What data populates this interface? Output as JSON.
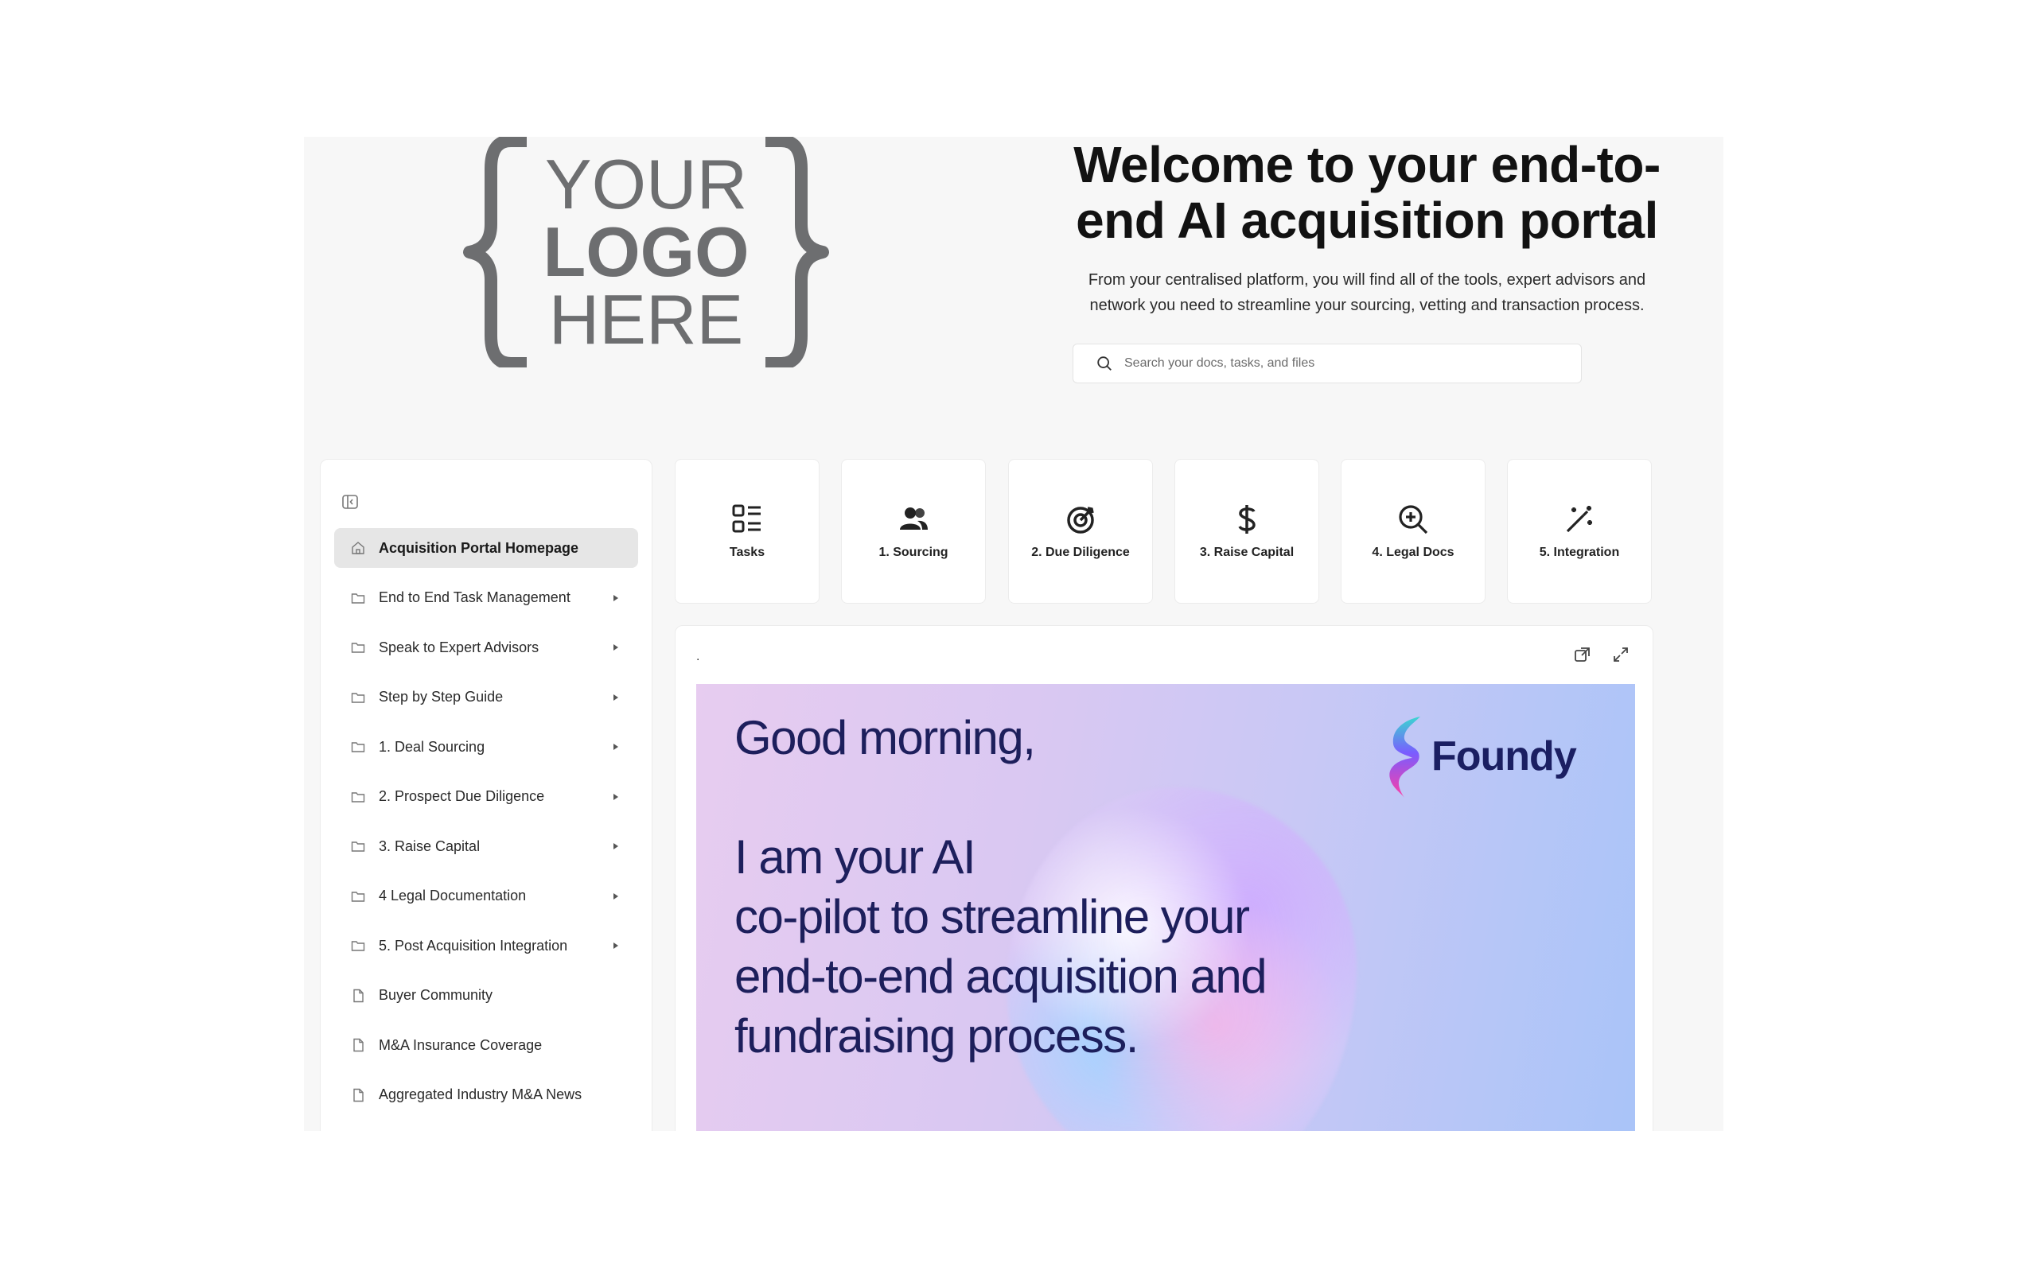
{
  "logo": {
    "line1": "YOUR",
    "line2": "LOGO",
    "line3": "HERE"
  },
  "hero": {
    "title_line1": "Welcome to your end-to-",
    "title_line2": "end AI acquisition portal",
    "subtitle_line1": "From your centralised platform, you will find all of the tools, expert advisors and",
    "subtitle_line2": "network you need to streamline your sourcing, vetting and transaction process."
  },
  "search": {
    "placeholder": "Search your docs, tasks, and files"
  },
  "sidebar": {
    "items": [
      {
        "label": "Acquisition Portal Homepage",
        "icon": "home-icon",
        "active": true
      },
      {
        "label": "End to End Task Management",
        "icon": "folder-icon",
        "expandable": true
      },
      {
        "label": "Speak to Expert Advisors",
        "icon": "folder-icon",
        "expandable": true
      },
      {
        "label": "Step by Step Guide",
        "icon": "folder-icon",
        "expandable": true
      },
      {
        "label": "1. Deal Sourcing",
        "icon": "folder-icon",
        "expandable": true
      },
      {
        "label": "2. Prospect Due Diligence",
        "icon": "folder-icon",
        "expandable": true
      },
      {
        "label": "3. Raise Capital",
        "icon": "folder-icon",
        "expandable": true
      },
      {
        "label": "4 Legal Documentation",
        "icon": "folder-icon",
        "expandable": true
      },
      {
        "label": "5. Post Acquisition Integration",
        "icon": "folder-icon",
        "expandable": true
      },
      {
        "label": "Buyer Community",
        "icon": "document-icon"
      },
      {
        "label": "M&A Insurance Coverage",
        "icon": "document-icon"
      },
      {
        "label": "Aggregated Industry M&A News",
        "icon": "document-icon"
      }
    ]
  },
  "tiles": [
    {
      "label": "Tasks",
      "icon": "tasks-grid-icon"
    },
    {
      "label": "1. Sourcing",
      "icon": "people-icon"
    },
    {
      "label": "2. Due Diligence",
      "icon": "target-icon"
    },
    {
      "label": "3. Raise Capital",
      "icon": "dollar-icon"
    },
    {
      "label": "4. Legal Docs",
      "icon": "zoom-in-icon"
    },
    {
      "label": "5. Integration",
      "icon": "magic-wand-icon"
    }
  ],
  "panel": {
    "marker": ".",
    "banner": {
      "line1": "Good morning,",
      "line2": "I am your AI",
      "line3": "co-pilot to streamline your",
      "line4": "end-to-end acquisition and",
      "line5": "fundraising process.",
      "brand": "Foundy"
    }
  },
  "colors": {
    "background": "#f7f7f7",
    "card": "#ffffff",
    "active_nav": "#e6e6e6",
    "banner_text": "#1d1f5c",
    "logo_gray": "#6d6e70"
  }
}
